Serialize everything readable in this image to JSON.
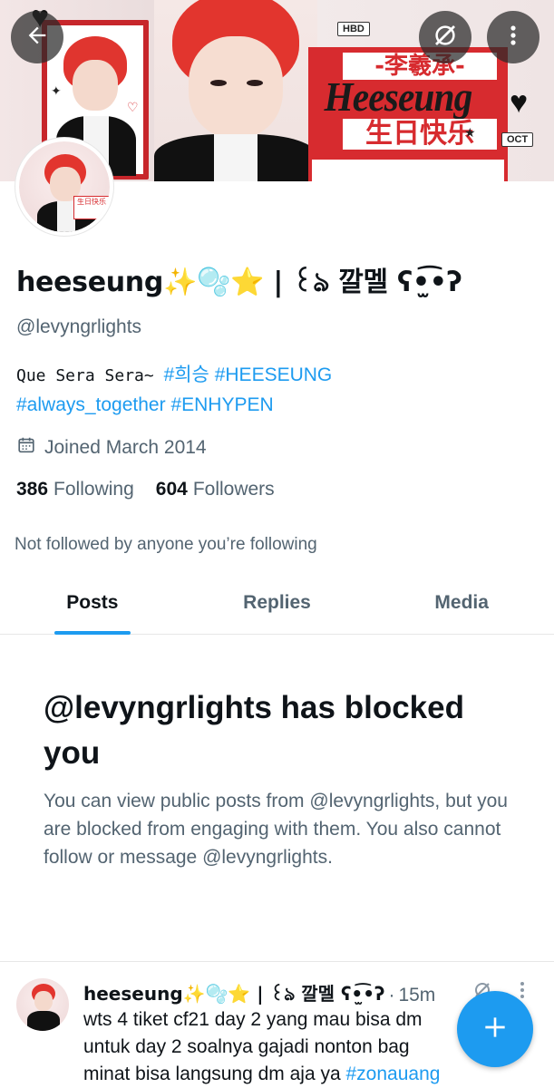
{
  "banner": {
    "tag_hbd": "HBD",
    "tag_oct": "OCT",
    "cn_name": "-李羲承-",
    "en_name": "Heeseung",
    "cn_birthday": "生日快乐",
    "avatar_badge": "生日快乐"
  },
  "profile": {
    "display_name": "heeseung✨🫧⭐ | ꒰ঌ 깔멜 ʕ•̫͡•ʔ",
    "handle": "@levyngrlights",
    "bio_plain": "Que Sera Sera~ ",
    "bio_tags_line1": "#희승 #HEESEUNG",
    "bio_tags_line2": "#always_together #ENHYPEN",
    "joined": "Joined March 2014",
    "following_count": "386",
    "following_label": "Following",
    "followers_count": "604",
    "followers_label": "Followers",
    "not_followed": "Not followed by anyone you’re following"
  },
  "tabs": [
    {
      "label": "Posts",
      "active": true
    },
    {
      "label": "Replies",
      "active": false
    },
    {
      "label": "Media",
      "active": false
    }
  ],
  "blocked": {
    "title": "@levyngrlights has blocked you",
    "description": "You can view public posts from @levyngrlights, but you are blocked from engaging with them. You also cannot follow or message @levyngrlights."
  },
  "tweet": {
    "name": "heeseung✨🫧⭐ | ꒰ঌ 깔멜 ʕ•̫͡•ʔ",
    "separator": "·",
    "time": "15m",
    "text_line1": "wts 4 tiket cf21 day 2 yang mau bisa dm",
    "text_line2": "untuk day 2 soalnya gajadi nonton bag",
    "text_line3": "minat bisa langsung dm aja ya ",
    "text_tag": "#zonauang"
  },
  "colors": {
    "accent": "#1d9bf0",
    "text_primary": "#0f1419",
    "text_secondary": "#536471",
    "banner_red": "#d72b2f"
  },
  "icons": [
    "back-arrow-icon",
    "grok-icon",
    "more-vertical-icon",
    "calendar-icon",
    "compose-plus-icon"
  ]
}
